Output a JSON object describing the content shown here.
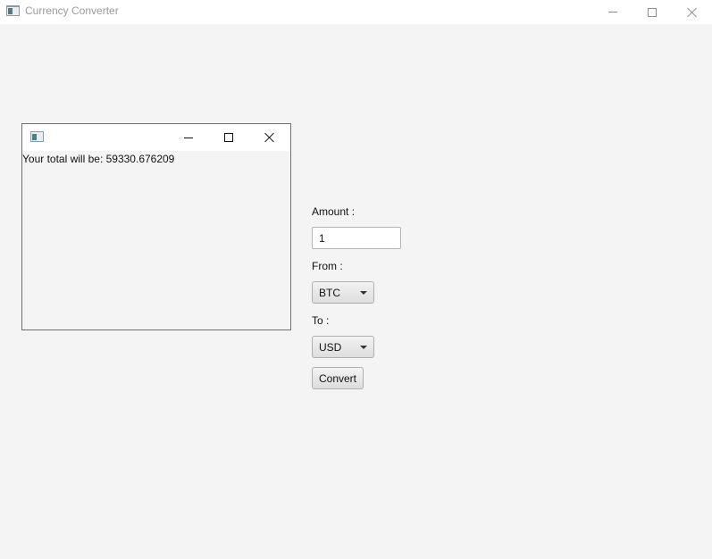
{
  "window": {
    "title": "Currency Converter",
    "icon": "app-window-icon"
  },
  "popup": {
    "icon": "app-window-icon",
    "result_text": "Your total will be: 59330.676209"
  },
  "form": {
    "amount_label": "Amount :",
    "amount_value": "1",
    "from_label": "From :",
    "from_value": "BTC",
    "to_label": "To :",
    "to_value": "USD",
    "convert_label": "Convert"
  },
  "icons": {
    "minimize": "minimize-icon",
    "maximize": "maximize-icon",
    "close": "close-icon",
    "dropdown": "chevron-down-icon"
  }
}
